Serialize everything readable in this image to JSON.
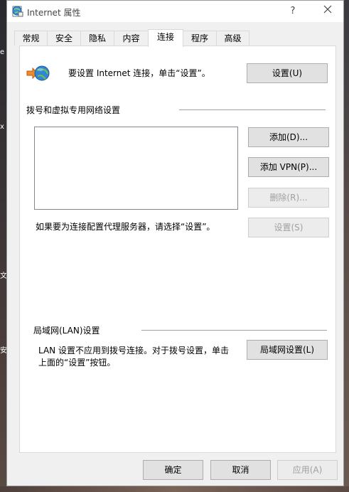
{
  "window": {
    "title": "Internet 属性",
    "help_glyph": "?",
    "close_glyph": "✕"
  },
  "tabs": [
    {
      "label": "常规"
    },
    {
      "label": "安全"
    },
    {
      "label": "隐私"
    },
    {
      "label": "内容"
    },
    {
      "label": "连接",
      "active": true
    },
    {
      "label": "程序"
    },
    {
      "label": "高级"
    }
  ],
  "setup": {
    "text": "要设置 Internet 连接，单击“设置”。",
    "button": "设置(U)"
  },
  "dialup": {
    "heading": "拨号和虚拟专用网络设置",
    "add_button": "添加(D)...",
    "add_vpn_button": "添加 VPN(P)...",
    "remove_button": "删除(R)...",
    "settings_button": "设置(S)",
    "proxy_hint": "如果要为连接配置代理服务器，请选择“设置”。"
  },
  "lan": {
    "heading": "局域网(LAN)设置",
    "note_line1": "LAN 设置不应用到拨号连接。对于拨号设置，单击",
    "note_line2": "上面的“设置”按钮。",
    "button": "局域网设置(L)"
  },
  "footer": {
    "ok": "确定",
    "cancel": "取消",
    "apply": "应用(A)"
  },
  "desktop_glyphs": [
    "e",
    "x",
    "文",
    "安"
  ]
}
